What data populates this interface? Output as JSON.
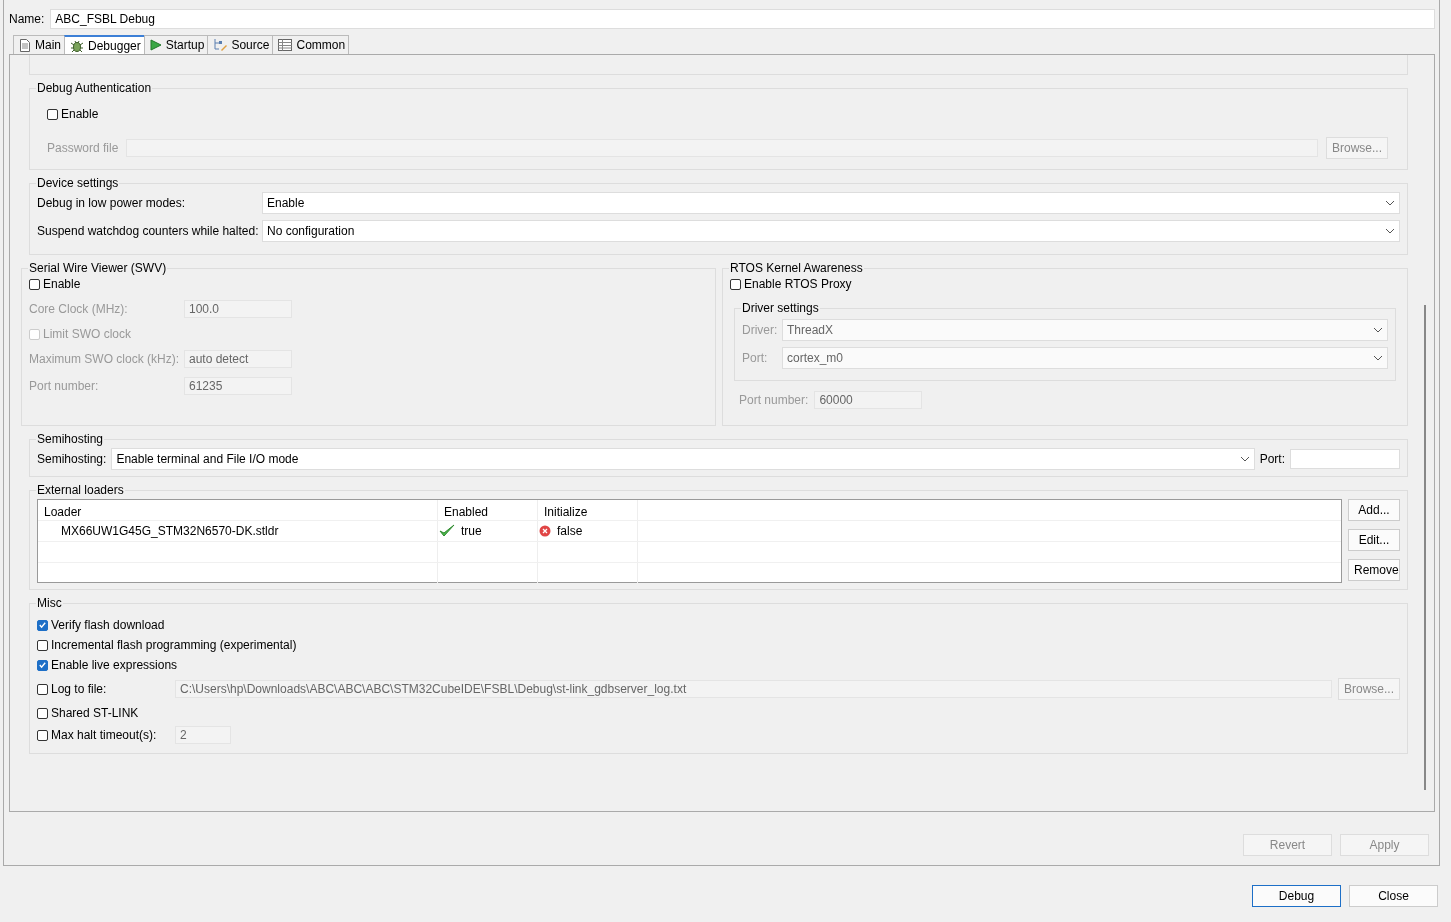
{
  "name_field": {
    "label": "Name:",
    "value": "ABC_FSBL Debug"
  },
  "tabs": [
    {
      "label": "Main",
      "kind": "page",
      "selected": false
    },
    {
      "label": "Debugger",
      "kind": "bug",
      "selected": true
    },
    {
      "label": "Startup",
      "kind": "play",
      "selected": false
    },
    {
      "label": "Source",
      "kind": "tree",
      "selected": false
    },
    {
      "label": "Common",
      "kind": "table",
      "selected": false
    }
  ],
  "debug_authentication": {
    "title": "Debug Authentication",
    "enable": {
      "label": "Enable",
      "checked": false
    },
    "password_file": {
      "label": "Password file",
      "disabled": true
    },
    "browse": {
      "label": "Browse...",
      "disabled": true
    }
  },
  "device_settings": {
    "title": "Device settings",
    "rows": [
      {
        "label": "Debug in low power modes:",
        "value": "Enable"
      },
      {
        "label": "Suspend watchdog counters while halted:",
        "value": "No configuration"
      }
    ]
  },
  "swv": {
    "title": "Serial Wire Viewer (SWV)",
    "enable": {
      "label": "Enable",
      "checked": false
    },
    "items": [
      {
        "kind": "field",
        "label": "Core Clock (MHz):",
        "value": "100.0",
        "disabled": true
      },
      {
        "kind": "checkbox",
        "label": "Limit SWO clock",
        "checked": false,
        "disabled": true
      },
      {
        "kind": "field",
        "label": "Maximum SWO clock (kHz):",
        "value": "auto detect",
        "disabled": true
      },
      {
        "kind": "field",
        "label": "Port number:",
        "value": "61235",
        "disabled": true
      }
    ]
  },
  "rtos": {
    "title": "RTOS Kernel Awareness",
    "enable": {
      "label": "Enable RTOS Proxy",
      "checked": false
    },
    "driver_settings": {
      "title": "Driver settings",
      "rows": [
        {
          "label": "Driver:",
          "value": "ThreadX",
          "disabled": true
        },
        {
          "label": "Port:",
          "value": "cortex_m0",
          "disabled": true
        }
      ]
    },
    "port_number": {
      "label": "Port number:",
      "value": "60000",
      "disabled": true
    }
  },
  "semihosting": {
    "title": "Semihosting",
    "label": "Semihosting:",
    "value": "Enable terminal and File I/O mode",
    "port_label": "Port:"
  },
  "external_loaders": {
    "title": "External loaders",
    "columns": [
      "Loader",
      "Enabled",
      "Initialize"
    ],
    "rows": [
      {
        "loader": "MX66UW1G45G_STM32N6570-DK.stldr",
        "enabled": {
          "text": "true",
          "on": true
        },
        "initialize": {
          "text": "false",
          "on": false
        }
      }
    ],
    "buttons": [
      "Add...",
      "Edit...",
      "Remove"
    ]
  },
  "misc": {
    "title": "Misc",
    "items": [
      {
        "kind": "checkbox",
        "label": "Verify flash download",
        "checked": true
      },
      {
        "kind": "checkbox",
        "label": "Incremental flash programming (experimental)",
        "checked": false
      },
      {
        "kind": "checkbox",
        "label": "Enable live expressions",
        "checked": true
      },
      {
        "kind": "path",
        "label": "Log to file:",
        "checked": false,
        "value": "C:\\Users\\hp\\Downloads\\ABC\\ABC\\ABC\\STM32CubeIDE\\FSBL\\Debug\\st-link_gdbserver_log.txt",
        "button": "Browse...",
        "disabled": true
      },
      {
        "kind": "checkbox",
        "label": "Shared ST-LINK",
        "checked": false
      },
      {
        "kind": "number",
        "label": "Max halt timeout(s):",
        "checked": false,
        "value": "2",
        "disabled": true
      }
    ]
  },
  "panel_buttons": [
    {
      "label": "Revert",
      "disabled": true
    },
    {
      "label": "Apply",
      "disabled": true
    }
  ],
  "dialog_buttons": [
    {
      "label": "Debug",
      "default": true
    },
    {
      "label": "Close",
      "default": false
    }
  ]
}
